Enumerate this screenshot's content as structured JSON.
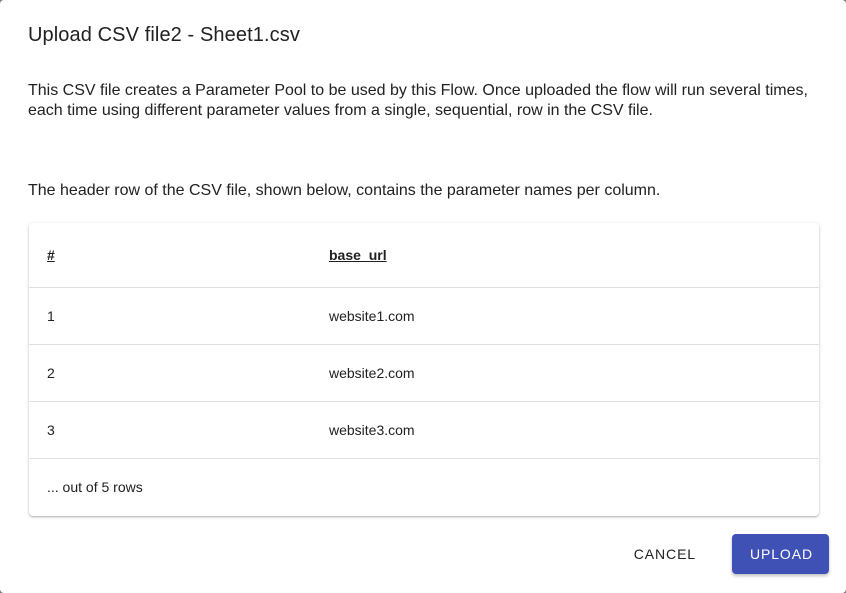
{
  "dialog": {
    "title": "Upload CSV file2 - Sheet1.csv",
    "description": "This CSV file creates a Parameter Pool to be used by this Flow. Once uploaded the flow will run several times, each time using different parameter values from a single, sequential, row in the CSV file.",
    "header_note": "The header row of the CSV file, shown below, contains the parameter names per column."
  },
  "table": {
    "headers": [
      "#",
      "base_url"
    ],
    "rows": [
      [
        "1",
        "website1.com"
      ],
      [
        "2",
        "website2.com"
      ],
      [
        "3",
        "website3.com"
      ]
    ],
    "footer": "... out of 5 rows"
  },
  "actions": {
    "cancel_label": "Cancel",
    "upload_label": "Upload"
  },
  "colors": {
    "primary": "#3f51b5"
  }
}
